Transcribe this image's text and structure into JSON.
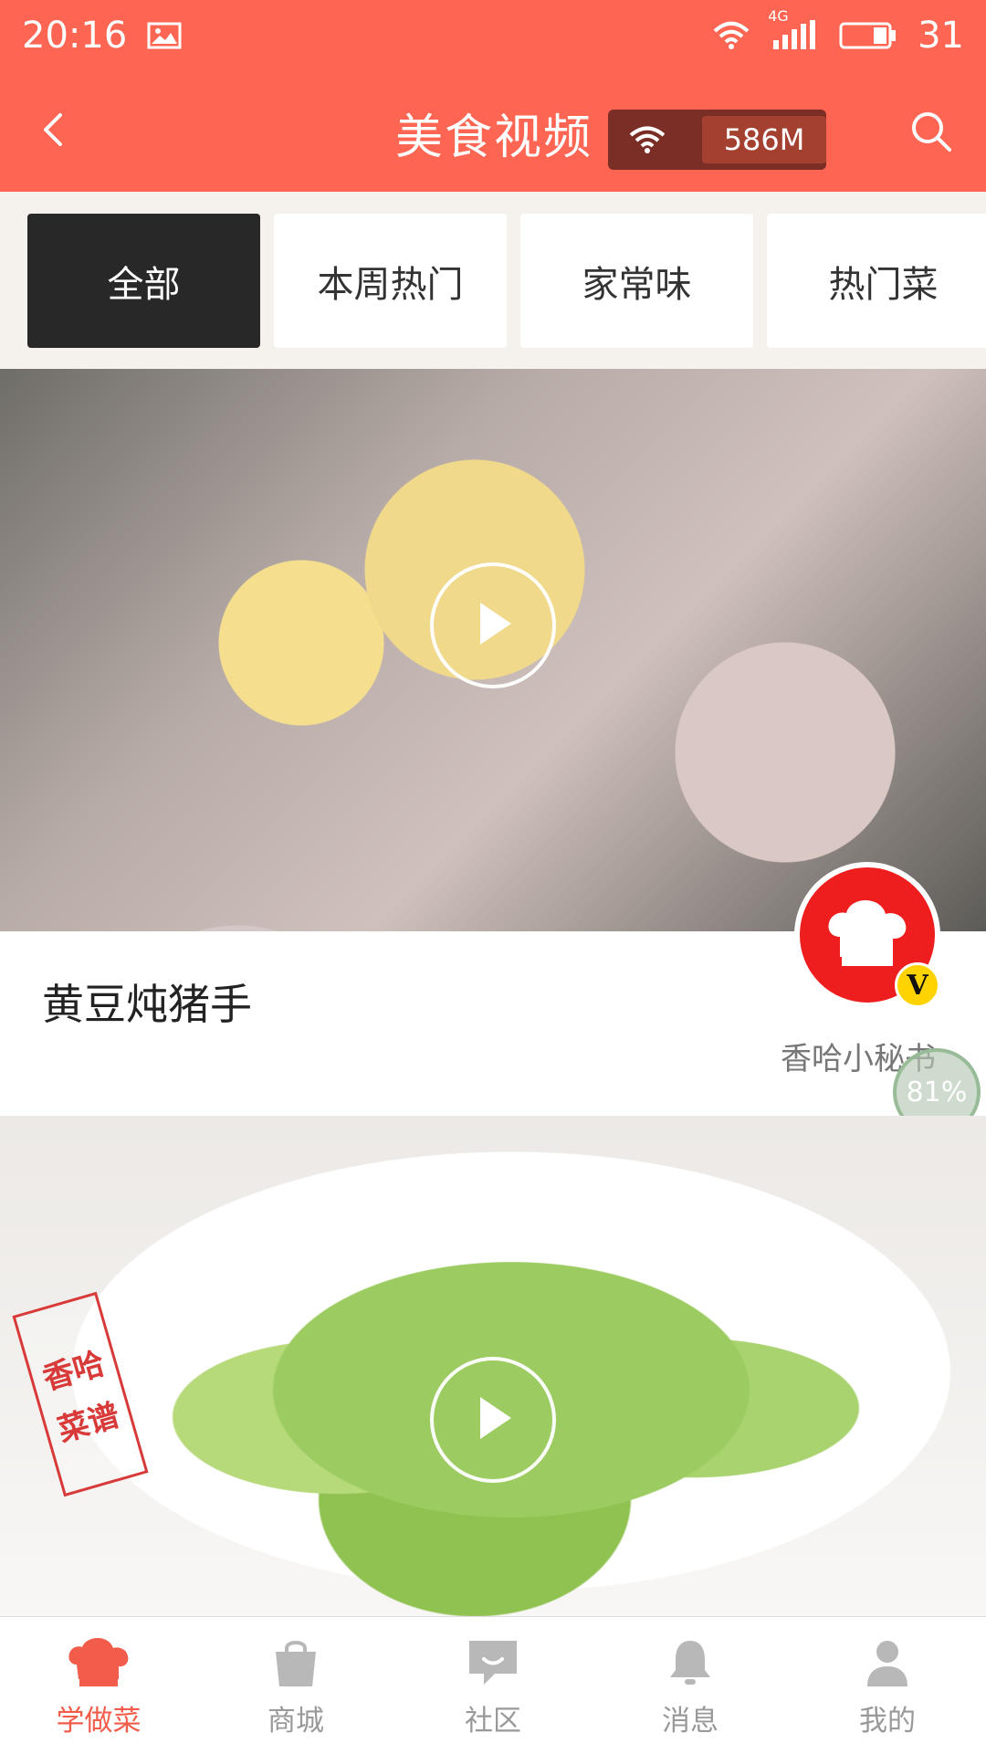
{
  "status_bar": {
    "time": "20:16",
    "network_type": "4G",
    "battery_level": "31",
    "icons": [
      "image-icon",
      "wifi-icon",
      "signal-icon",
      "battery-icon"
    ]
  },
  "header": {
    "title": "美食视频",
    "network_usage": "586M",
    "back_icon": "chevron-left-icon",
    "search_icon": "search-icon"
  },
  "tabs": [
    {
      "label": "全部",
      "active": true
    },
    {
      "label": "本周热门",
      "active": false
    },
    {
      "label": "家常味",
      "active": false
    },
    {
      "label": "热门菜",
      "active": false
    }
  ],
  "feed": {
    "cards": [
      {
        "title": "黄豆炖猪手",
        "author": "香哈小秘书",
        "verified_badge": "V"
      }
    ],
    "watermark": {
      "line1": "香哈",
      "line2": "菜谱"
    },
    "progress": "81%"
  },
  "bottom_nav": {
    "items": [
      {
        "label": "学做菜",
        "icon": "chef-hat-icon",
        "active": true
      },
      {
        "label": "商城",
        "icon": "shopping-bag-icon",
        "active": false
      },
      {
        "label": "社区",
        "icon": "chat-icon",
        "active": false
      },
      {
        "label": "消息",
        "icon": "bell-icon",
        "active": false
      },
      {
        "label": "我的",
        "icon": "user-icon",
        "active": false
      }
    ]
  },
  "colors": {
    "brand": "#fe6552",
    "active_tab": "#282828",
    "nav_active": "#f25c4a"
  }
}
